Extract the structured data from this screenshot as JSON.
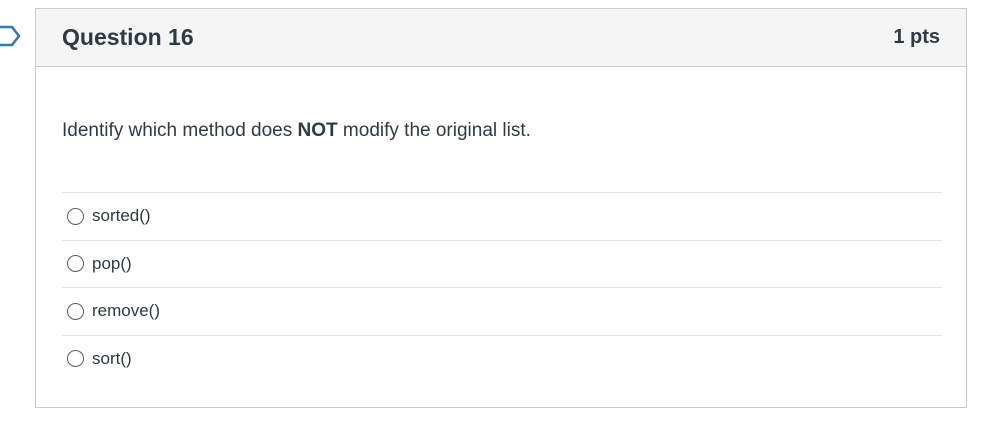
{
  "question": {
    "title": "Question 16",
    "points": "1 pts",
    "text_before": "Identify which method does ",
    "text_bold": "NOT",
    "text_after": " modify the original list."
  },
  "answers": [
    {
      "label": "sorted()",
      "selected": false
    },
    {
      "label": "pop()",
      "selected": false
    },
    {
      "label": "remove()",
      "selected": false
    },
    {
      "label": "sort()",
      "selected": false
    }
  ]
}
